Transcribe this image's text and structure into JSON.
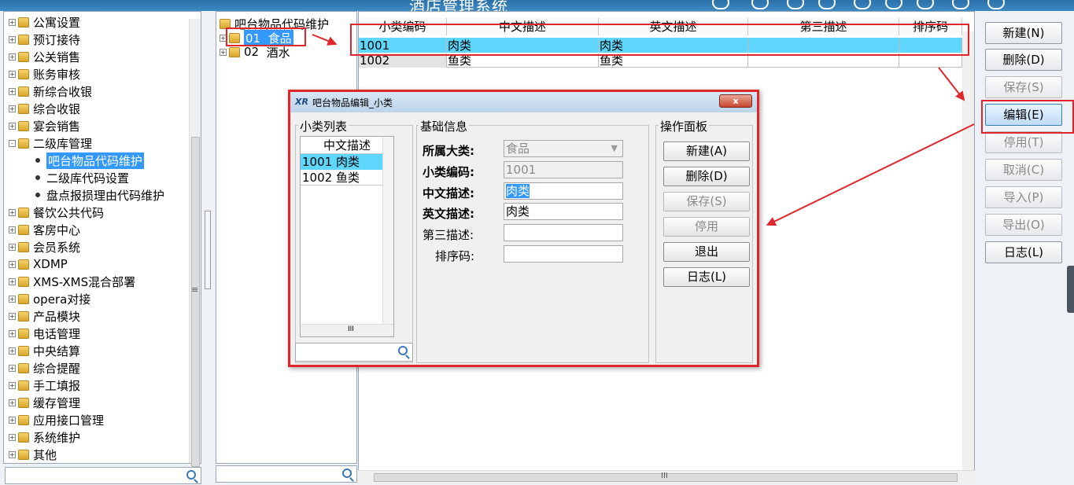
{
  "app": {
    "title": "酒店管理系统"
  },
  "left_tree": {
    "items": [
      {
        "label": "公寓设置"
      },
      {
        "label": "预订接待"
      },
      {
        "label": "公关销售"
      },
      {
        "label": "账务审核"
      },
      {
        "label": "新综合收银"
      },
      {
        "label": "综合收银"
      },
      {
        "label": "宴会销售"
      },
      {
        "label": "二级库管理"
      },
      {
        "label": "吧台物品代码维护"
      },
      {
        "label": "二级库代码设置"
      },
      {
        "label": "盘点报损理由代码维护"
      },
      {
        "label": "餐饮公共代码"
      },
      {
        "label": "客房中心"
      },
      {
        "label": "会员系统"
      },
      {
        "label": "XDMP"
      },
      {
        "label": "XMS-XMS混合部署"
      },
      {
        "label": "opera对接"
      },
      {
        "label": "产品模块"
      },
      {
        "label": "电话管理"
      },
      {
        "label": "中央结算"
      },
      {
        "label": "综合提醒"
      },
      {
        "label": "手工填报"
      },
      {
        "label": "缓存管理"
      },
      {
        "label": "应用接口管理"
      },
      {
        "label": "系统维护"
      },
      {
        "label": "其他"
      }
    ],
    "search_value": ""
  },
  "mid_tree": {
    "root": "吧台物品代码维护",
    "items": [
      {
        "code": "01",
        "label": "食品"
      },
      {
        "code": "02",
        "label": "酒水"
      }
    ],
    "search_value": ""
  },
  "grid": {
    "columns": [
      "小类编码",
      "中文描述",
      "英文描述",
      "第三描述",
      "排序码"
    ],
    "rows": [
      {
        "code": "1001",
        "cn": "肉类",
        "en": "肉类",
        "third": "",
        "sort": ""
      },
      {
        "code": "1002",
        "cn": "鱼类",
        "en": "鱼类",
        "third": "",
        "sort": ""
      }
    ]
  },
  "buttons": {
    "new": "新建(N)",
    "delete": "删除(D)",
    "save": "保存(S)",
    "edit": "编辑(E)",
    "disable": "停用(T)",
    "cancel": "取消(C)",
    "import": "导入(P)",
    "export": "导出(O)",
    "log": "日志(L)"
  },
  "dialog": {
    "logo": "XR",
    "title": "吧台物品编辑_小类",
    "close": "x",
    "list_group": "小类列表",
    "list_header": "中文描述",
    "list_items": [
      "1001 肉类",
      "1002 鱼类"
    ],
    "list_hscroll": "III",
    "info_group": "基础信息",
    "fields": {
      "category_label": "所属大类:",
      "category_value": "食品",
      "code_label": "小类编码:",
      "code_value": "1001",
      "cn_label": "中文描述:",
      "cn_value": "肉类",
      "en_label": "英文描述:",
      "en_value": "肉类",
      "third_label": "第三描述:",
      "third_value": "",
      "sort_label": "排序码:",
      "sort_value": ""
    },
    "panel_group": "操作面板",
    "panel_buttons": {
      "new": "新建(A)",
      "delete": "删除(D)",
      "save": "保存(S)",
      "disable": "停用",
      "exit": "退出",
      "log": "日志(L)"
    }
  },
  "scroll_glyphs": {
    "grid_h": "III",
    "left_v": "≡"
  },
  "colors": {
    "selection": "#3399ff",
    "row_highlight": "#5fd6fb",
    "annotation_red": "#e0262a"
  }
}
